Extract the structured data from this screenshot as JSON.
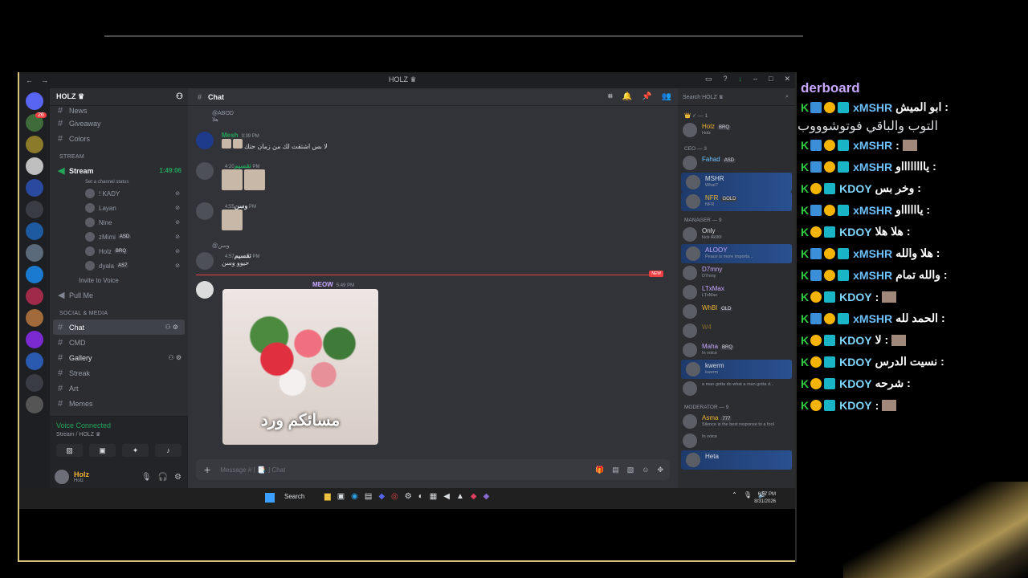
{
  "colors": {
    "accent_green": "#23a55a",
    "blurple": "#5865f2",
    "leaderboard_title": "#c9a8ff",
    "xmshr": "#6ec1ff",
    "kdoy": "#7fd7ff"
  },
  "window": {
    "title": "HOLZ ♛"
  },
  "guilds": {
    "badge": "26"
  },
  "server": {
    "name": "HOLZ ♛"
  },
  "channels": {
    "top_partial": "News",
    "giveaway": "Giveaway",
    "colors": "Colors",
    "stream_category": "STREAM",
    "stream": "Stream",
    "stream_time": "1:49:06",
    "stream_status": "Set a channel status",
    "voice_users": [
      {
        "name": "! KADY",
        "tag": ""
      },
      {
        "name": "Layan",
        "tag": ""
      },
      {
        "name": "Nine",
        "tag": ""
      },
      {
        "name": "zMimi",
        "tag": "ASD"
      },
      {
        "name": "Holz",
        "tag": "BRQ"
      },
      {
        "name": "dyala",
        "tag": "AS7"
      }
    ],
    "invite": "Invite to Voice",
    "pull_me": "Pull Me",
    "social_category": "SOCIAL & MEDIA",
    "chat": "Chat",
    "cmd": "CMD",
    "gallery": "Gallery",
    "streak": "Streak",
    "art": "Art",
    "memes": "Memes"
  },
  "voice_panel": {
    "title": "Voice Connected",
    "sub": "Stream / HOLZ ♛"
  },
  "user_panel": {
    "name": "Holz",
    "sub": "Holz"
  },
  "main": {
    "channel": "Chat",
    "messages": [
      {
        "reply": "@ABOD هلا",
        "name": "Mesh",
        "time": "3:39 PM",
        "text": "لا بس اشتقت لك من زمان حتك"
      },
      {
        "name": "تقسيم",
        "time": "4:20 PM",
        "text": ""
      },
      {
        "name": "وسن",
        "time": "4:55 PM",
        "text": ""
      },
      {
        "reply": "@وسن",
        "name": "تقسيم",
        "time": "4:57 PM",
        "text": "حيوو وسن"
      },
      {
        "name": "MEOW",
        "time": "5:49 PM",
        "text": ""
      }
    ],
    "new_label": "NEW",
    "image_caption": "مسائكم ورد",
    "composer_placeholder": "Message # ⌈ 📑 ⌋ Chat"
  },
  "members": {
    "search_placeholder": "Search HOLZ ♛",
    "groups": [
      {
        "label": "👑 ✓ — 1",
        "items": [
          {
            "name": "Holz",
            "sub": "Holz",
            "tag": "BRQ",
            "color": "#f0b232",
            "hl": false
          }
        ]
      },
      {
        "label": "CEO — 3",
        "items": [
          {
            "name": "Fahad",
            "sub": "",
            "tag": "ASD",
            "color": "#6ec1ff",
            "hl": false
          },
          {
            "name": "MSHR",
            "sub": "What?",
            "tag": "",
            "color": "#dbdee1",
            "hl": true
          },
          {
            "name": "NFR",
            "sub": "NFR",
            "tag": "GOLD",
            "color": "#f0b232",
            "hl": true
          }
        ]
      },
      {
        "label": "MANAGER — 9",
        "items": [
          {
            "name": "Only",
            "sub": "kick Ak90l",
            "tag": "",
            "color": "#dbdee1",
            "hl": false
          },
          {
            "name": "ALOOY",
            "sub": "Peace is more importa...",
            "tag": "",
            "color": "#c9a8ff",
            "hl": true
          },
          {
            "name": "D7mny",
            "sub": "D7mny",
            "tag": "",
            "color": "#c9a8ff",
            "hl": false
          },
          {
            "name": "LTxMax",
            "sub": "LTxMax",
            "tag": "",
            "color": "#c9a8ff",
            "hl": false
          },
          {
            "name": "WhBl",
            "sub": "",
            "tag": "OLD",
            "color": "#f0b232",
            "hl": false
          },
          {
            "name": "W4",
            "sub": "",
            "tag": "",
            "color": "#8a6a2a",
            "hl": false
          },
          {
            "name": "Maha",
            "sub": "In voice",
            "tag": "BRQ",
            "color": "#c9a8ff",
            "hl": false
          },
          {
            "name": "kwerm",
            "sub": "kwerm",
            "tag": "",
            "color": "#dbdee1",
            "hl": true
          },
          {
            "name": "",
            "sub": "a man gotta do what a man gotta d...",
            "tag": "",
            "color": "#dbdee1",
            "hl": false
          }
        ]
      },
      {
        "label": "MODERATOR — 9",
        "items": [
          {
            "name": "Asma",
            "sub": "Silence is the best response to a fool",
            "tag": "777",
            "color": "#f0b232",
            "hl": false
          },
          {
            "name": "",
            "sub": "In voice",
            "tag": "",
            "color": "#dbdee1",
            "hl": false
          },
          {
            "name": "Heta",
            "sub": "",
            "tag": "",
            "color": "#dbdee1",
            "hl": true
          }
        ]
      }
    ]
  },
  "taskbar": {
    "search": "Search",
    "time": "6:57 PM",
    "date": "8/31/2026"
  },
  "leaderboard": {
    "title": "derboard",
    "rows": [
      {
        "user": "xMSHR",
        "text": "ابو الميش :",
        "wrap": "التوب والباقي فوتوشوووب",
        "emoji": false,
        "pin": true
      },
      {
        "user": "xMSHR",
        "text": ":",
        "wrap": "",
        "emoji": true,
        "pin": true
      },
      {
        "user": "xMSHR",
        "text": "يااااااااو :",
        "wrap": "",
        "emoji": false,
        "pin": true
      },
      {
        "user": "KDOY",
        "text": "وخر بس :",
        "wrap": "",
        "emoji": false,
        "pin": false
      },
      {
        "user": "xMSHR",
        "text": "يااااااو :",
        "wrap": "",
        "emoji": false,
        "pin": true
      },
      {
        "user": "KDOY",
        "text": "هلا هلا :",
        "wrap": "",
        "emoji": false,
        "pin": false
      },
      {
        "user": "xMSHR",
        "text": "هلا والله :",
        "wrap": "",
        "emoji": false,
        "pin": true
      },
      {
        "user": "xMSHR",
        "text": "والله تمام :",
        "wrap": "",
        "emoji": false,
        "pin": true
      },
      {
        "user": "KDOY",
        "text": ":",
        "wrap": "",
        "emoji": true,
        "pin": false
      },
      {
        "user": "xMSHR",
        "text": "الحمد لله :",
        "wrap": "",
        "emoji": false,
        "pin": true
      },
      {
        "user": "KDOY",
        "text": "لا :",
        "wrap": "",
        "emoji": true,
        "pin": false
      },
      {
        "user": "KDOY",
        "text": "نسيت الدرس :",
        "wrap": "",
        "emoji": false,
        "pin": false
      },
      {
        "user": "KDOY",
        "text": "شرحه :",
        "wrap": "",
        "emoji": false,
        "pin": false
      },
      {
        "user": "KDOY",
        "text": ":",
        "wrap": "",
        "emoji": true,
        "pin": false
      }
    ]
  }
}
